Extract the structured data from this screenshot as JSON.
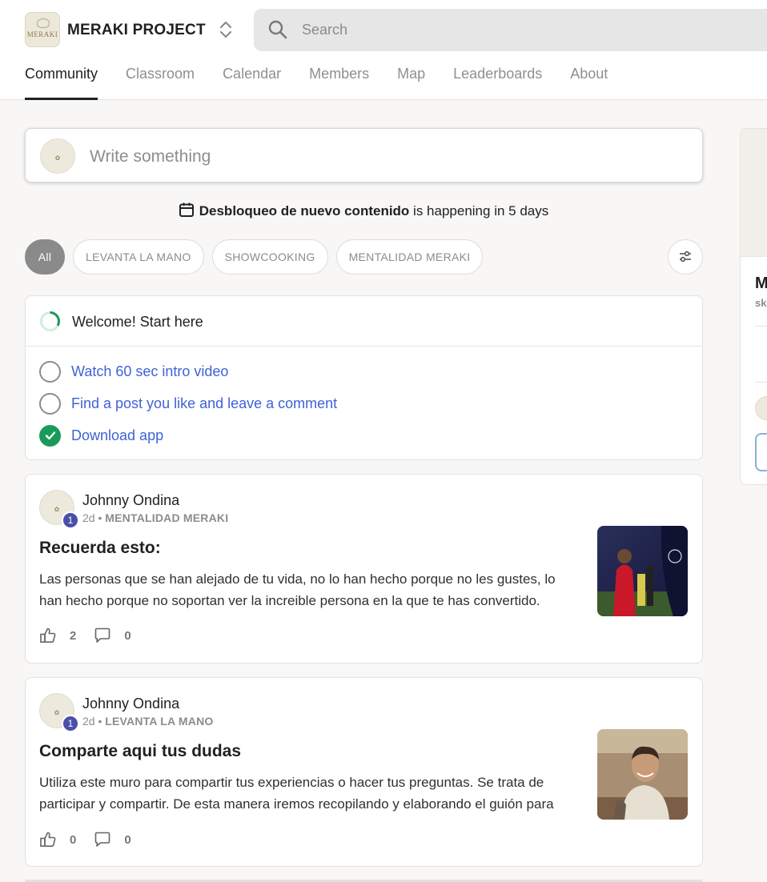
{
  "header": {
    "project_name": "MERAKI PROJECT",
    "logo_text": "MERAKI",
    "search_placeholder": "Search"
  },
  "tabs": [
    {
      "label": "Community",
      "active": true
    },
    {
      "label": "Classroom",
      "active": false
    },
    {
      "label": "Calendar",
      "active": false
    },
    {
      "label": "Members",
      "active": false
    },
    {
      "label": "Map",
      "active": false
    },
    {
      "label": "Leaderboards",
      "active": false
    },
    {
      "label": "About",
      "active": false
    }
  ],
  "composer": {
    "placeholder": "Write something"
  },
  "event": {
    "title": "Desbloqueo de nuevo contenido",
    "suffix": " is happening in 5 days"
  },
  "filters": {
    "chips": [
      "All",
      "LEVANTA LA MANO",
      "SHOWCOOKING",
      "MENTALIDAD MERAKI"
    ],
    "selected": "All"
  },
  "welcome": {
    "title": "Welcome! Start here",
    "progress": 0.33,
    "tasks": [
      {
        "label": "Watch 60 sec intro video",
        "done": false
      },
      {
        "label": "Find a post you like and leave a comment",
        "done": false
      },
      {
        "label": "Download app",
        "done": true
      }
    ]
  },
  "posts": [
    {
      "author": "Johnny Ondina",
      "level": "1",
      "time": "2d",
      "separator": " • ",
      "category": "MENTALIDAD MERAKI",
      "title": "Recuerda esto:",
      "body": "Las personas que se han alejado de tu vida, no lo han hecho porque no les gustes, lo han hecho porque no soportan ver la increible persona en la que te has convertido.",
      "likes": "2",
      "comments": "0"
    },
    {
      "author": "Johnny Ondina",
      "level": "1",
      "time": "2d",
      "separator": " • ",
      "category": "LEVANTA LA MANO",
      "title": "Comparte aqui tus dudas",
      "body": "Utiliza este muro para compartir tus experiencias o hacer tus preguntas. Se trata de participar y compartir. De esta manera iremos recopilando y elaborando el guión para",
      "likes": "0",
      "comments": "0"
    }
  ],
  "side_card": {
    "initial": "M",
    "sub": "sk"
  },
  "colors": {
    "link_blue": "#3f62d6",
    "done_green": "#1a9a5a",
    "level_badge": "#4b4fa7",
    "chip_active": "#8a8a8a"
  }
}
